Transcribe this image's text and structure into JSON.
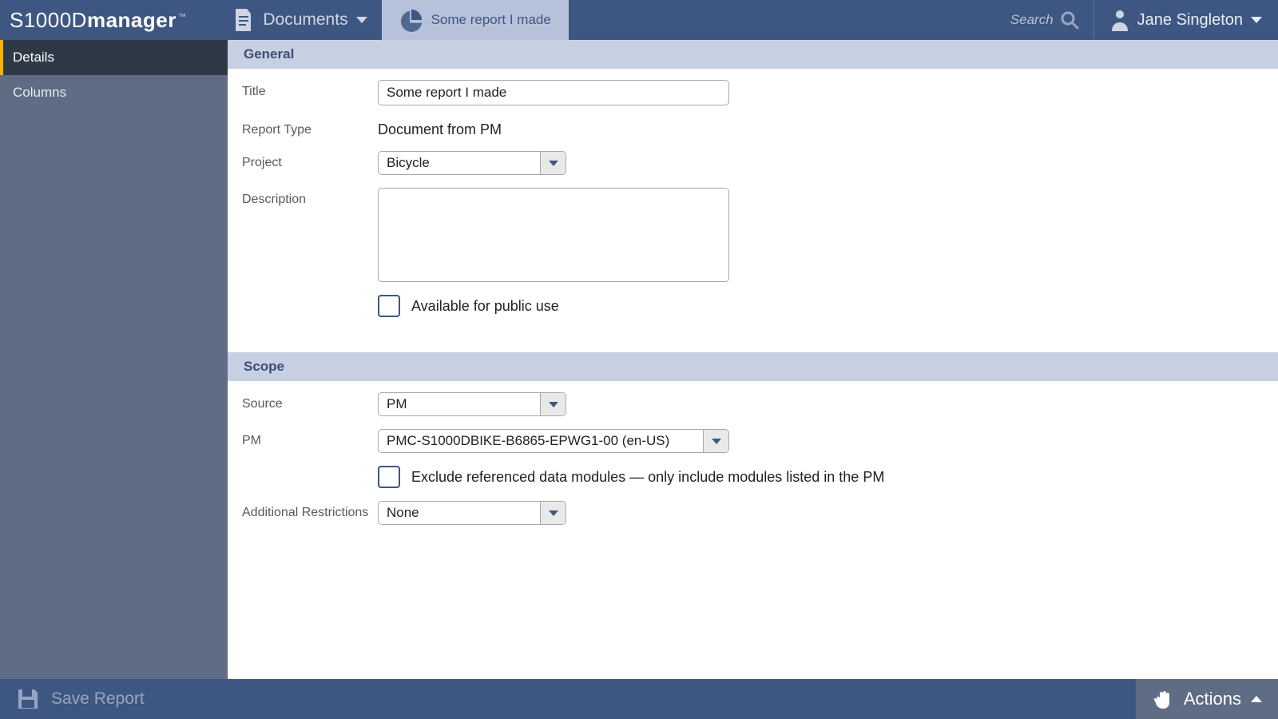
{
  "header": {
    "app_name_light": "S1000D",
    "app_name_bold": "manager",
    "nav_documents": "Documents",
    "report_tab": "Some report I made",
    "search_label": "Search",
    "user_name": "Jane Singleton"
  },
  "sidebar": {
    "items": [
      {
        "label": "Details",
        "active": true
      },
      {
        "label": "Columns",
        "active": false
      }
    ]
  },
  "sections": {
    "general": {
      "heading": "General",
      "title_label": "Title",
      "title_value": "Some report I made",
      "type_label": "Report Type",
      "type_value": "Document from PM",
      "project_label": "Project",
      "project_value": "Bicycle",
      "description_label": "Description",
      "description_value": "",
      "public_label": "Available for public use",
      "public_checked": false
    },
    "scope": {
      "heading": "Scope",
      "source_label": "Source",
      "source_value": "PM",
      "pm_label": "PM",
      "pm_value": "PMC-S1000DBIKE-B6865-EPWG1-00 (en-US)",
      "exclude_label": "Exclude referenced data modules — only include modules listed in the PM",
      "exclude_checked": false,
      "restrictions_label": "Additional Restrictions",
      "restrictions_value": "None"
    }
  },
  "footer": {
    "save_label": "Save Report",
    "actions_label": "Actions"
  }
}
